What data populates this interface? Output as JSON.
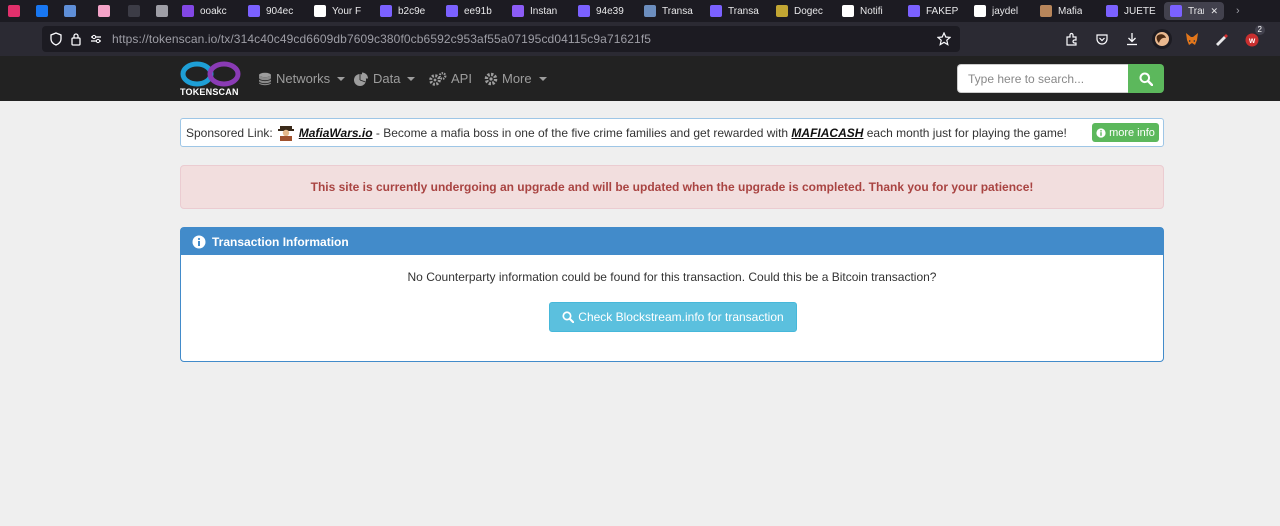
{
  "browser": {
    "tabs": [
      {
        "label": "",
        "color": "#e1306c"
      },
      {
        "label": "",
        "color": "#1877f2"
      },
      {
        "label": "",
        "color": "#5f8fd8"
      },
      {
        "label": "",
        "color": "#f4a3c8"
      },
      {
        "label": "",
        "color": "#3c3c46"
      },
      {
        "label": "",
        "color": "#9e9ea6"
      },
      {
        "label": "ooakc",
        "color": "#8247e5"
      },
      {
        "label": "904ec",
        "color": "#7b61ff"
      },
      {
        "label": "Your F",
        "color": "#ffffff"
      },
      {
        "label": "b2c9e",
        "color": "#7b61ff"
      },
      {
        "label": "ee91b",
        "color": "#7b61ff"
      },
      {
        "label": "Instan",
        "color": "#8c5cf6"
      },
      {
        "label": "94e39",
        "color": "#7b61ff"
      },
      {
        "label": "Transa",
        "color": "#6c8ebf"
      },
      {
        "label": "Transa",
        "color": "#7b61ff"
      },
      {
        "label": "Dogec",
        "color": "#c2a633"
      },
      {
        "label": "Notifi",
        "color": "#ffffff"
      },
      {
        "label": "FAKEP",
        "color": "#7b61ff"
      },
      {
        "label": "jaydel",
        "color": "#ffffff"
      },
      {
        "label": "Mafia",
        "color": "#b8865b"
      },
      {
        "label": "JUETE",
        "color": "#7b61ff"
      },
      {
        "label": "Tran",
        "color": "#7b61ff"
      }
    ],
    "url_host": "https://tokenscan.io",
    "url_path": "/tx/314c40c49cd6609db7609c380f0cb6592c953af55a07195cd04115c9a71621f5",
    "addon_badge": "2"
  },
  "navbar": {
    "logo_text": "TOKENSCAN",
    "networks_label": "Networks",
    "data_label": "Data",
    "api_label": "API",
    "more_label": "More",
    "search_placeholder": "Type here to search..."
  },
  "sponsored": {
    "prefix": "Sponsored Link:",
    "site": "MafiaWars.io",
    "text1": " - Become a mafia boss in one of the five crime families and get rewarded with ",
    "token": "MAFIACASH",
    "text2": " each month just for playing the game!",
    "more_info": "more info"
  },
  "alert": {
    "message": "This site is currently undergoing an upgrade and will be updated when the upgrade is completed. Thank you for your patience!"
  },
  "panel": {
    "title": "Transaction Information",
    "message": "No Counterparty information could be found for this transaction. Could this be a Bitcoin transaction?",
    "button_label": "Check Blockstream.info for transaction"
  }
}
